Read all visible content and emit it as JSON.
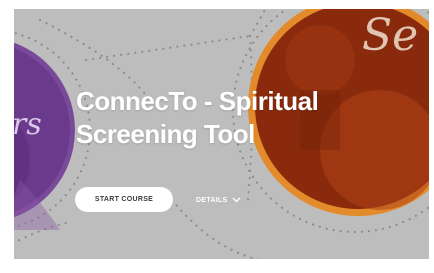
{
  "hero": {
    "title_line1": "ConnecTo - Spiritual",
    "title_line2": "Screening Tool",
    "left_image_text": "rs",
    "right_image_text": "Se"
  },
  "actions": {
    "start_label": "START COURSE",
    "details_label": "DETAILS"
  },
  "icons": {
    "details_chevron": "chevron-down-icon"
  },
  "colors": {
    "background": "#bdbdbd",
    "left_circle": "#6a3a8c",
    "right_circle_ring": "#d97a1e",
    "right_circle_fill": "#8a2a0c",
    "button_bg": "#ffffff"
  }
}
